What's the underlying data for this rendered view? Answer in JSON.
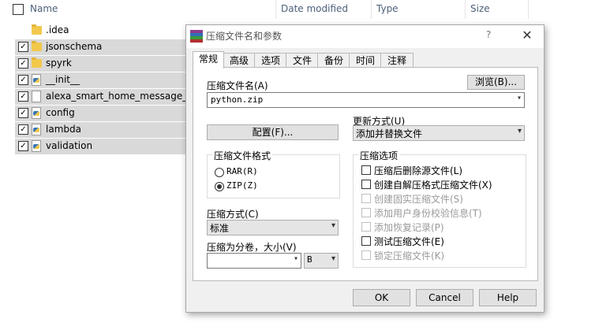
{
  "explorer": {
    "columns": {
      "name": "Name",
      "date_modified": "Date modified",
      "type": "Type",
      "size": "Size"
    },
    "files": [
      {
        "name": ".idea",
        "kind": "folder-icon",
        "selected": false
      },
      {
        "name": "jsonschema",
        "kind": "folder-icon",
        "selected": true
      },
      {
        "name": "spyrk",
        "kind": "folder-icon",
        "selected": true
      },
      {
        "name": "__init__",
        "kind": "python-file-icon",
        "selected": true
      },
      {
        "name": "alexa_smart_home_message_sche",
        "kind": "text-file-icon",
        "selected": true
      },
      {
        "name": "config",
        "kind": "python-file-icon",
        "selected": true
      },
      {
        "name": "lambda",
        "kind": "python-file-icon",
        "selected": true
      },
      {
        "name": "validation",
        "kind": "python-file-icon",
        "selected": true
      }
    ]
  },
  "dialog": {
    "title": "压缩文件名和参数",
    "help": "?",
    "close": "✕",
    "tabs": [
      "常规",
      "高级",
      "选项",
      "文件",
      "备份",
      "时间",
      "注释"
    ],
    "archive_name_label": "压缩文件名(A)",
    "browse_label": "浏览(B)...",
    "archive_name_value": "python.zip",
    "update_mode_label": "更新方式(U)",
    "update_mode_value": "添加并替换文件",
    "profiles_label": "配置(F)...",
    "format_group": "压缩文件格式",
    "format_rar": "RAR(R)",
    "format_zip": "ZIP(Z)",
    "method_label": "压缩方式(C)",
    "method_value": "标准",
    "split_label": "压缩为分卷，大小(V)",
    "split_value": "",
    "split_unit": "B",
    "options_group": "压缩选项",
    "options": [
      {
        "label": "压缩后删除源文件(L)",
        "enabled": true
      },
      {
        "label": "创建自解压格式压缩文件(X)",
        "enabled": true
      },
      {
        "label": "创建固实压缩文件(S)",
        "enabled": false
      },
      {
        "label": "添加用户身份校验信息(T)",
        "enabled": false
      },
      {
        "label": "添加恢复记录(P)",
        "enabled": false
      },
      {
        "label": "测试压缩文件(E)",
        "enabled": true
      },
      {
        "label": "锁定压缩文件(K)",
        "enabled": false
      }
    ],
    "ok": "OK",
    "cancel": "Cancel",
    "help_button": "Help"
  }
}
